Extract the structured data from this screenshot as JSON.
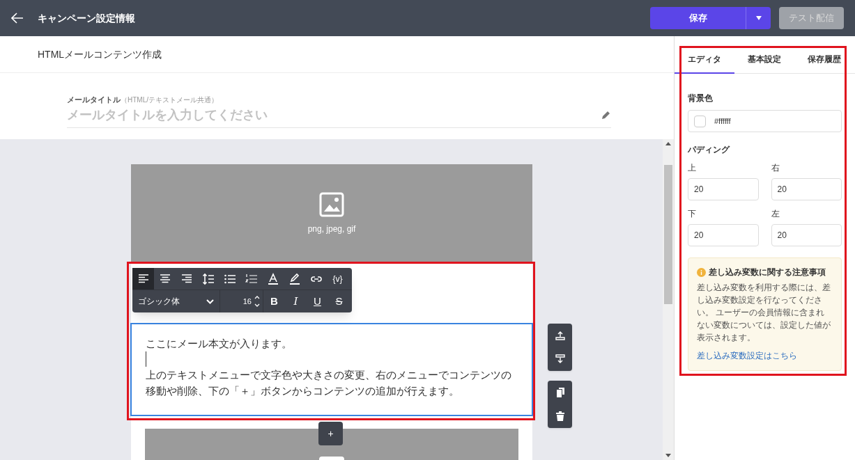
{
  "header": {
    "title": "キャンペーン設定情報",
    "save_label": "保存",
    "test_label": "テスト配信",
    "test_disabled": true
  },
  "page_heading": "HTMLメールコンテンツ作成",
  "mail_title": {
    "label": "メールタイトル",
    "note": "（HTML/テキストメール共通）",
    "placeholder": "メールタイトルを入力してください"
  },
  "image_block": {
    "caption": "png, jpeg, gif"
  },
  "toolbar": {
    "row1": [
      {
        "kind": "align-left",
        "selected": true
      },
      {
        "kind": "align-center",
        "selected": false
      },
      {
        "kind": "align-right",
        "selected": false
      },
      {
        "kind": "line-height",
        "selected": false
      },
      {
        "kind": "bullet-list",
        "selected": false
      },
      {
        "kind": "numbered-list",
        "selected": false
      },
      {
        "kind": "text-color",
        "selected": false
      },
      {
        "kind": "highlight",
        "selected": false
      },
      {
        "kind": "link",
        "selected": false
      },
      {
        "kind": "variable",
        "label": "{v}",
        "selected": false
      }
    ],
    "font": "ゴシック体",
    "size": "16",
    "row2": [
      {
        "kind": "bold",
        "label": "B"
      },
      {
        "kind": "italic",
        "label": "I"
      },
      {
        "kind": "underline",
        "label": "U"
      },
      {
        "kind": "strike",
        "label": "S"
      }
    ]
  },
  "text_block": {
    "paragraphs": [
      "ここにメール本文が入ります。",
      "上のテキストメニューで文字色や大きさの変更、右のメニューでコンテンツの移動や削除、下の「＋」ボタンからコンテンツの追加が行えます。"
    ]
  },
  "add_button": "+",
  "tabs": [
    {
      "label": "エディタ",
      "selected": true
    },
    {
      "label": "基本設定",
      "selected": false
    },
    {
      "label": "保存履歴",
      "selected": false
    }
  ],
  "background": {
    "label": "背景色",
    "value": "#ffffff",
    "color": "#ffffff"
  },
  "padding": {
    "label": "パディング",
    "fields": [
      {
        "label": "上",
        "value": "20"
      },
      {
        "label": "右",
        "value": "20"
      },
      {
        "label": "下",
        "value": "20"
      },
      {
        "label": "左",
        "value": "20"
      }
    ]
  },
  "notice": {
    "title": "差し込み変数に関する注意事項",
    "body": "差し込み変数を利用する際には、差し込み変数設定を行なってください。 ユーザーの会員情報に含まれない変数については、設定した値が表示されます。",
    "link": "差し込み変数設定はこちら"
  }
}
